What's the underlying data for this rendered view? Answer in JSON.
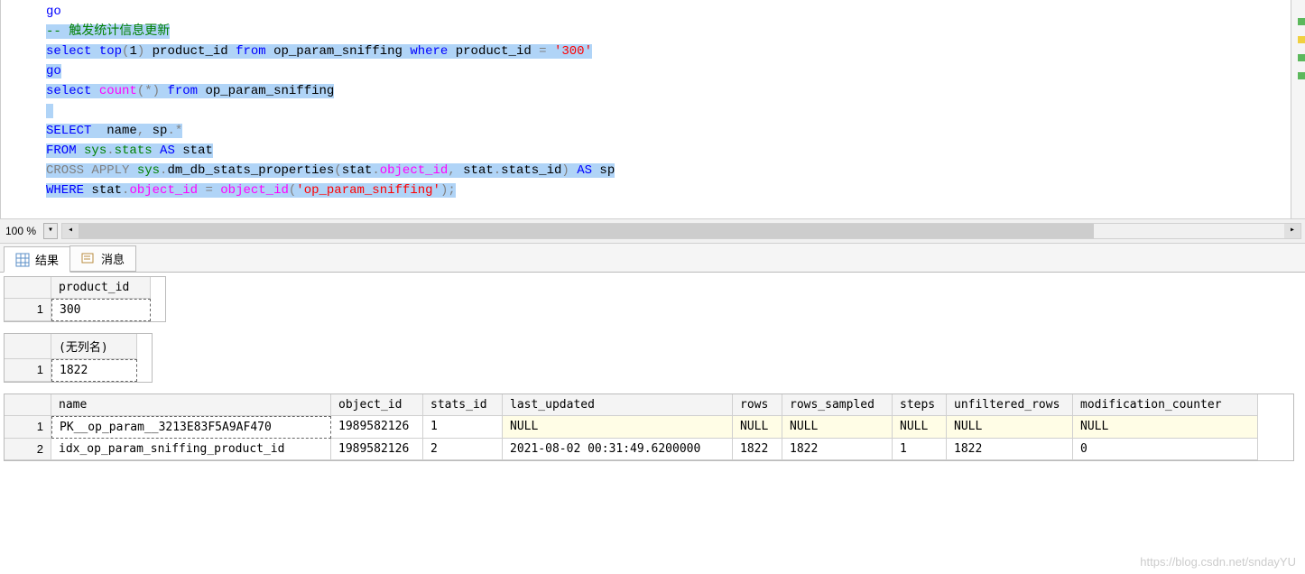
{
  "zoom": "100 %",
  "code": {
    "line1_go": "go",
    "line2_comment": "-- 触发统计信息更新",
    "line3_a": "select",
    "line3_b": " top",
    "line3_c": "(",
    "line3_d": "1",
    "line3_e": ")",
    "line3_f": " product_id ",
    "line3_g": "from",
    "line3_h": " op_param_sniffing ",
    "line3_i": "where",
    "line3_j": " product_id ",
    "line3_k": "=",
    "line3_l": " '300'",
    "line4_go": "go",
    "line5_a": "select",
    "line5_b": " count",
    "line5_c": "(*)",
    "line5_d": " from",
    "line5_e": " op_param_sniffing",
    "line7_a": "SELECT",
    "line7_b": "  name",
    "line7_c": ",",
    "line7_d": " sp",
    "line7_e": ".",
    "line7_f": "*",
    "line8_a": "FROM",
    "line8_b": " sys",
    "line8_c": ".",
    "line8_d": "stats ",
    "line8_e": "AS",
    "line8_f": " stat",
    "line9_a": "CROSS",
    "line9_b": " APPLY",
    "line9_c": " sys",
    "line9_d": ".",
    "line9_e": "dm_db_stats_properties",
    "line9_f": "(",
    "line9_g": "stat",
    "line9_h": ".",
    "line9_i": "object_id",
    "line9_j": ",",
    "line9_k": " stat",
    "line9_l": ".",
    "line9_m": "stats_id",
    "line9_n": ")",
    "line9_o": " AS",
    "line9_p": " sp",
    "line10_a": "WHERE",
    "line10_b": " stat",
    "line10_c": ".",
    "line10_d": "object_id",
    "line10_e": " =",
    "line10_f": " object_id",
    "line10_g": "(",
    "line10_h": "'op_param_sniffing'",
    "line10_i": ");"
  },
  "tabs": {
    "results": "结果",
    "messages": "消息"
  },
  "grid1": {
    "header": "product_id",
    "row1_num": "1",
    "row1_val": "300"
  },
  "grid2": {
    "header": "(无列名)",
    "row1_num": "1",
    "row1_val": "1822"
  },
  "grid3": {
    "h0": "name",
    "h1": "object_id",
    "h2": "stats_id",
    "h3": "last_updated",
    "h4": "rows",
    "h5": "rows_sampled",
    "h6": "steps",
    "h7": "unfiltered_rows",
    "h8": "modification_counter",
    "r1_num": "1",
    "r1_0": "PK__op_param__3213E83F5A9AF470",
    "r1_1": "1989582126",
    "r1_2": "1",
    "r1_3": "NULL",
    "r1_4": "NULL",
    "r1_5": "NULL",
    "r1_6": "NULL",
    "r1_7": "NULL",
    "r1_8": "NULL",
    "r2_num": "2",
    "r2_0": "idx_op_param_sniffing_product_id",
    "r2_1": "1989582126",
    "r2_2": "2",
    "r2_3": "2021-08-02 00:31:49.6200000",
    "r2_4": "1822",
    "r2_5": "1822",
    "r2_6": "1",
    "r2_7": "1822",
    "r2_8": "0"
  },
  "watermark": "https://blog.csdn.net/sndayYU"
}
